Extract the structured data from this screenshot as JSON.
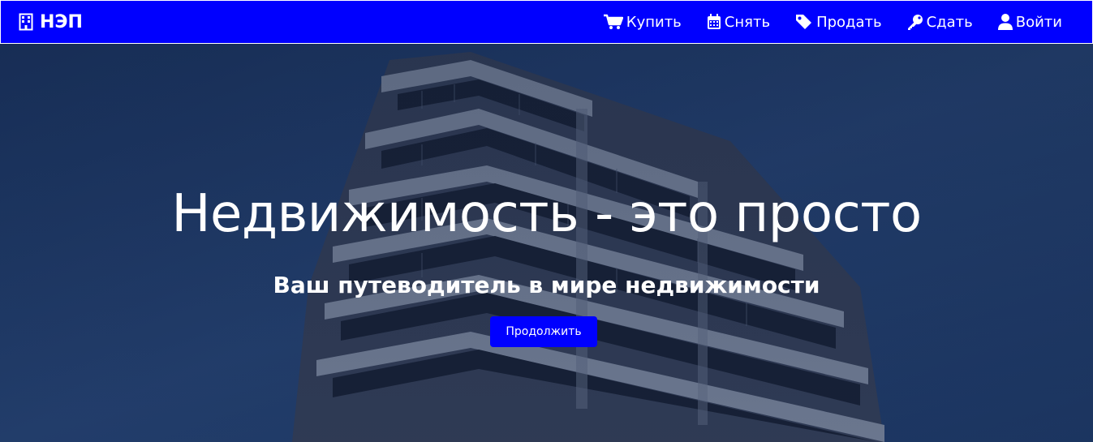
{
  "colors": {
    "primary": "#0000ff",
    "text": "#ffffff",
    "overlay": "#0e1f45"
  },
  "navbar": {
    "brand": {
      "label": "НЭП",
      "icon": "building-icon"
    },
    "items": [
      {
        "label": "Купить",
        "icon": "cart-icon"
      },
      {
        "label": "Снять",
        "icon": "calendar-icon"
      },
      {
        "label": "Продать",
        "icon": "tag-icon"
      },
      {
        "label": "Сдать",
        "icon": "key-icon"
      },
      {
        "label": "Войти",
        "icon": "user-icon"
      }
    ]
  },
  "hero": {
    "background": "building-photo",
    "title": "Недвижимость - это просто",
    "subtitle": "Ваш путеводитель в мире недвижимости",
    "button_label": "Продолжить"
  }
}
